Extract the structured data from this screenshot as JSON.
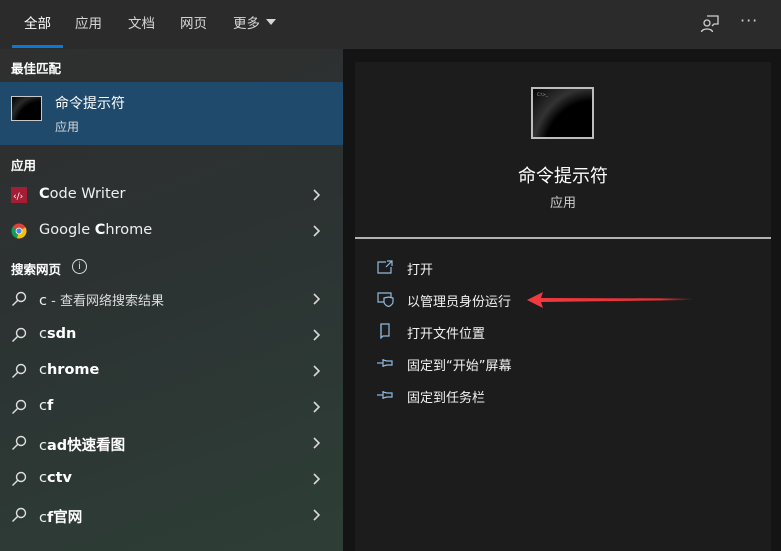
{
  "tabs": [
    {
      "label": "全部",
      "active": true
    },
    {
      "label": "应用",
      "active": false
    },
    {
      "label": "文档",
      "active": false
    },
    {
      "label": "网页",
      "active": false
    },
    {
      "label": "更多",
      "active": false,
      "has_dropdown": true
    }
  ],
  "top_icons": {
    "feedback": "feedback-person-icon",
    "more": "···"
  },
  "left": {
    "best_match_title": "最佳匹配",
    "best_match": {
      "name": "命令提示符",
      "type": "应用",
      "icon": "command-prompt-icon"
    },
    "apps_title": "应用",
    "apps": [
      {
        "prefix": "C",
        "rest": "ode Writer",
        "icon": "code-writer-icon"
      },
      {
        "prefix": "Google ",
        "bold": "C",
        "rest": "hrome",
        "icon": "chrome-icon"
      }
    ],
    "web_title": "搜索网页",
    "web_info_glyph": "i",
    "web_results": [
      {
        "query": "c",
        "suffix": " - 查看网络搜索结果"
      },
      {
        "query": "c",
        "suffix": "sdn"
      },
      {
        "query": "c",
        "suffix": "hrome"
      },
      {
        "query": "c",
        "suffix": "f"
      },
      {
        "query": "c",
        "suffix": "ad快速看图"
      },
      {
        "query": "c",
        "suffix": "ctv"
      },
      {
        "query": "c",
        "suffix": "f官网"
      }
    ]
  },
  "right": {
    "app_name": "命令提示符",
    "app_type": "应用",
    "actions": [
      {
        "label": "打开",
        "icon": "open-icon"
      },
      {
        "label": "以管理员身份运行",
        "icon": "shield-admin-icon"
      },
      {
        "label": "打开文件位置",
        "icon": "folder-location-icon"
      },
      {
        "label": "固定到“开始”屏幕",
        "icon": "pin-icon"
      },
      {
        "label": "固定到任务栏",
        "icon": "pin-icon"
      }
    ],
    "annotation_arrow_color": "#e8333a"
  },
  "colors": {
    "accent": "#0a78d4",
    "selected": "#1f4a6c",
    "action_icon": "#8fb9e0"
  }
}
